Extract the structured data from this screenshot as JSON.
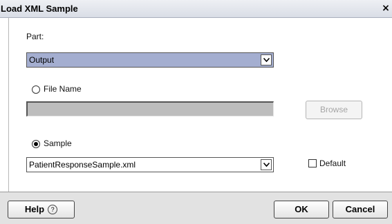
{
  "dialog": {
    "title": "Load XML Sample",
    "close_glyph": "×"
  },
  "part": {
    "label": "Part:",
    "selected": "Output",
    "selected_bg": "#a4aed0"
  },
  "file_name": {
    "label": "File Name",
    "selected": false,
    "value": "",
    "browse_label": "Browse"
  },
  "sample": {
    "label": "Sample",
    "selected": true,
    "file": "PatientResponseSample.xml",
    "default_label": "Default",
    "default_checked": false
  },
  "footer": {
    "help_label": "Help",
    "help_icon": "question-circle-icon",
    "ok_label": "OK",
    "cancel_label": "Cancel"
  }
}
